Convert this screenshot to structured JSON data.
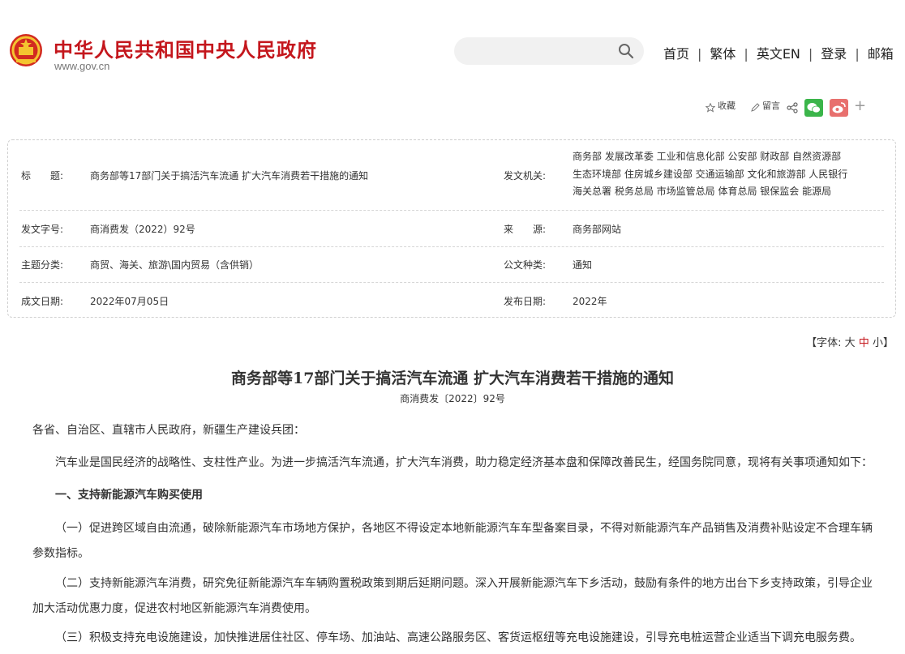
{
  "header": {
    "site_title": "中华人民共和国中央人民政府",
    "site_url": "www.gov.cn",
    "search_placeholder": "",
    "nav": [
      "首页",
      "繁体",
      "英文EN",
      "登录",
      "邮箱"
    ],
    "nav_sep": "|"
  },
  "share": {
    "favorite": "收藏",
    "comment": "留言"
  },
  "info": {
    "title_label": "标　　题:",
    "title_value": "商务部等17部门关于搞活汽车流通 扩大汽车消费若干措施的通知",
    "issuer_label": "发文机关:",
    "issuer_lines": [
      "商务部 发展改革委 工业和信息化部 公安部 财政部 自然资源部",
      "生态环境部 住房城乡建设部 交通运输部 文化和旅游部 人民银行",
      "海关总署 税务总局 市场监管总局 体育总局 银保监会 能源局"
    ],
    "docno_label": "发文字号:",
    "docno_value": "商消费发（2022）92号",
    "source_label": "来　　源:",
    "source_value": "商务部网站",
    "topic_label": "主题分类:",
    "topic_value": "商贸、海关、旅游\\国内贸易（含供销）",
    "doctype_label": "公文种类:",
    "doctype_value": "通知",
    "date_label": "成文日期:",
    "date_value": "2022年07月05日",
    "pubdate_label": "发布日期:",
    "pubdate_value": "2022年"
  },
  "fontsize": {
    "prefix": "【字体:",
    "large": "大",
    "medium": "中",
    "small": "小】"
  },
  "article": {
    "title": "商务部等17部门关于搞活汽车流通 扩大汽车消费若干措施的通知",
    "docno": "商消费发〔2022〕92号",
    "p1": "各省、自治区、直辖市人民政府，新疆生产建设兵团：",
    "p2": "汽车业是国民经济的战略性、支柱性产业。为进一步搞活汽车流通，扩大汽车消费，助力稳定经济基本盘和保障改善民生，经国务院同意，现将有关事项通知如下：",
    "h1": "一、支持新能源汽车购买使用",
    "p3": "（一）促进跨区域自由流通，破除新能源汽车市场地方保护，各地区不得设定本地新能源汽车车型备案目录，不得对新能源汽车产品销售及消费补贴设定不合理车辆参数指标。",
    "p4": "（二）支持新能源汽车消费，研究免征新能源汽车车辆购置税政策到期后延期问题。深入开展新能源汽车下乡活动，鼓励有条件的地方出台下乡支持政策，引导企业加大活动优惠力度，促进农村地区新能源汽车消费使用。",
    "p5": "（三）积极支持充电设施建设，加快推进居住社区、停车场、加油站、高速公路服务区、客货运枢纽等充电设施建设，引导充电桩运营企业适当下调充电服务费。"
  }
}
